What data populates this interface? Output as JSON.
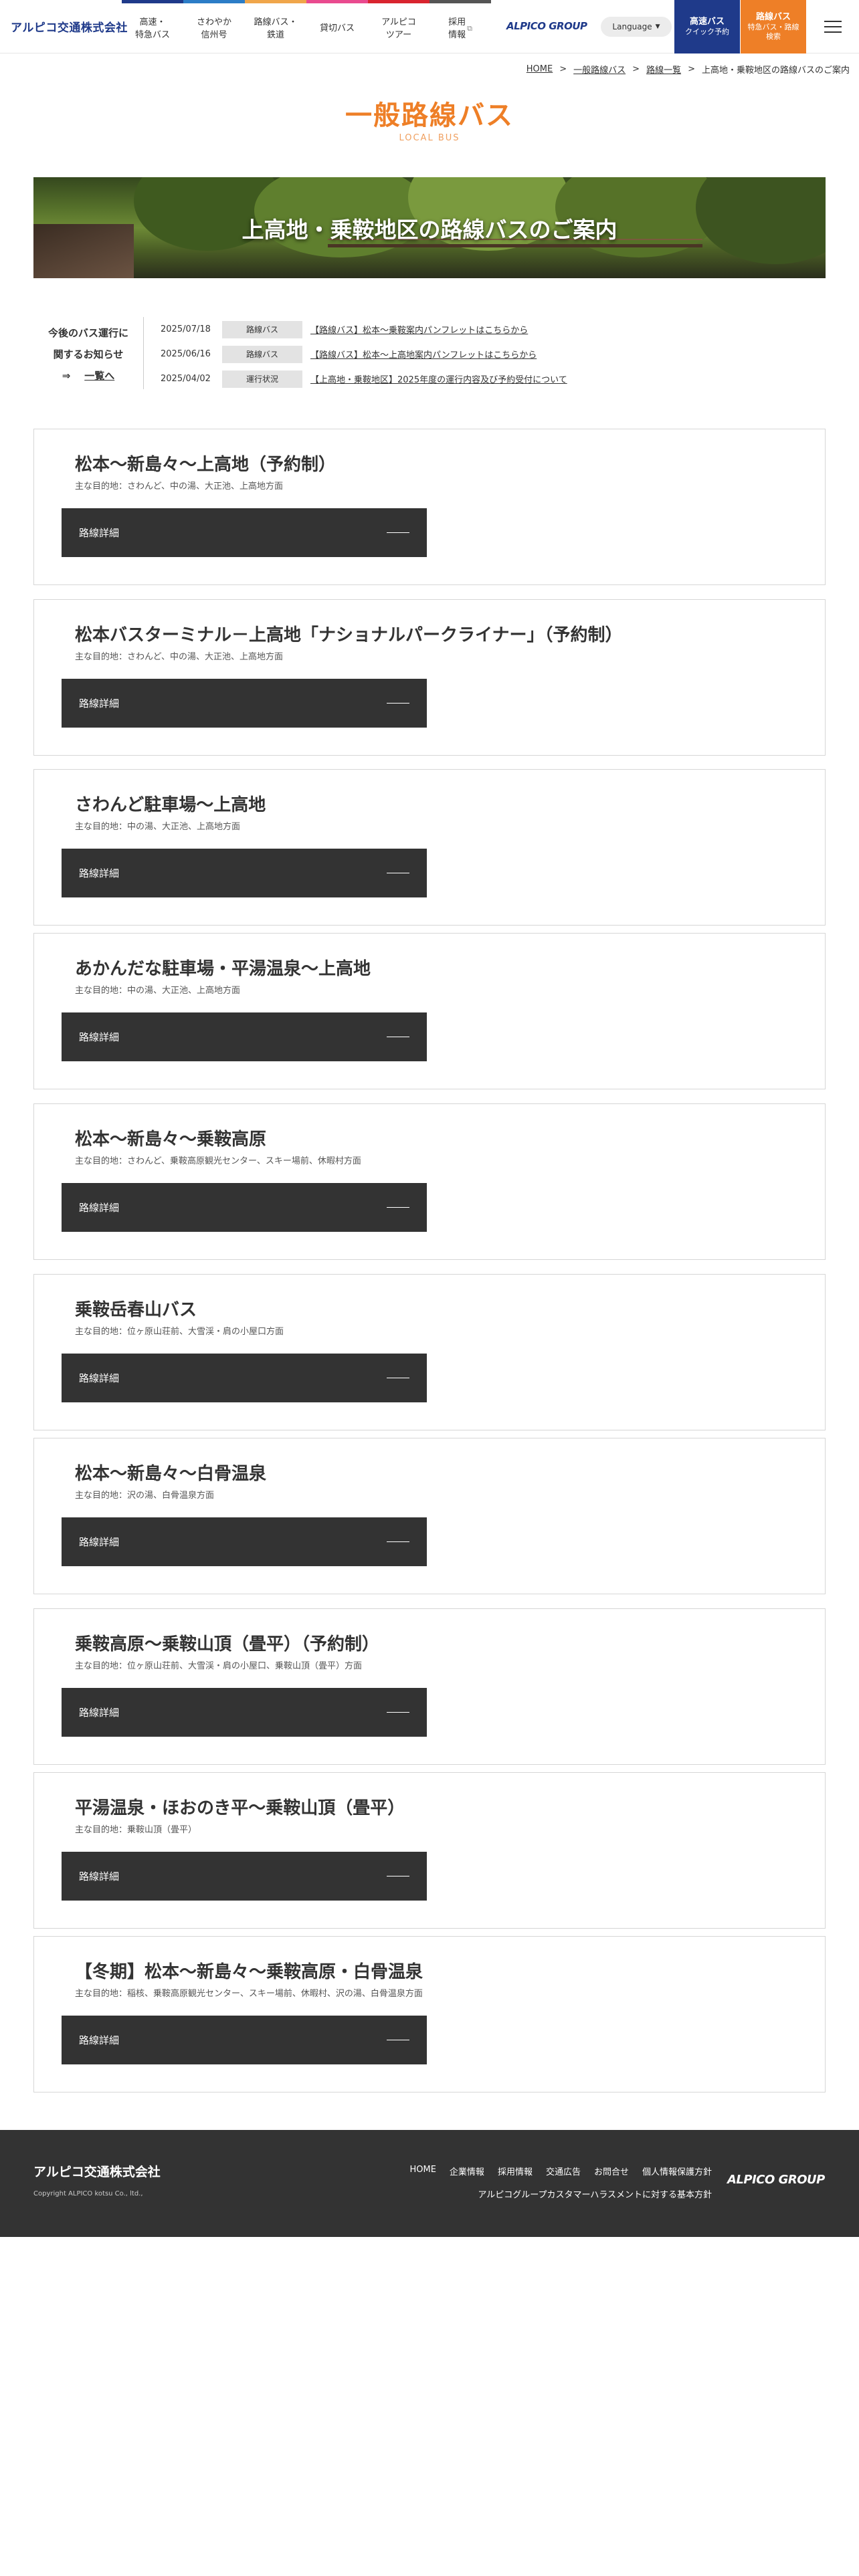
{
  "header": {
    "logo": "アルピコ交通株式会社",
    "nav": [
      {
        "label": "高速・\n特急バス",
        "color": "#1f3a8a",
        "external": false
      },
      {
        "label": "さわやか\n信州号",
        "color": "#2c7dc7",
        "external": false
      },
      {
        "label": "路線バス・\n鉄道",
        "color": "#f0a64a",
        "external": false
      },
      {
        "label": "貸切バス",
        "color": "#e94a8f",
        "external": false
      },
      {
        "label": "アルピコ\nツアー",
        "color": "#d9242f",
        "external": false
      },
      {
        "label": "採用\n情報",
        "color": "#555555",
        "external": true
      }
    ],
    "external_icon": "⧉",
    "group_logo": "ALPICO GROUP",
    "language": "Language",
    "cta_highway": {
      "title": "高速バス",
      "sub": "クイック予約"
    },
    "cta_route": {
      "title": "路線バス",
      "sub": "特急バス・路線\n検索"
    }
  },
  "breadcrumb": {
    "items": [
      "HOME",
      "一般路線バス",
      "路線一覧"
    ],
    "separator": ">",
    "current": "上高地・乗鞍地区の路線バスのご案内"
  },
  "page": {
    "title": "一般路線バス",
    "subtitle": "LOCAL BUS",
    "hero_title": "上高地・乗鞍地区の路線バスのご案内"
  },
  "news": {
    "heading_line1": "今後のバス運行に",
    "heading_line2": "関するお知らせ",
    "more_arrow": "⇒",
    "more": "一覧へ",
    "items": [
      {
        "date": "2025/07/18",
        "tag": "路線バス",
        "text": "【路線バス】松本～乗鞍案内パンフレットはこちらから"
      },
      {
        "date": "2025/06/16",
        "tag": "路線バス",
        "text": "【路線バス】松本～上高地案内パンフレットはこちらから"
      },
      {
        "date": "2025/04/02",
        "tag": "運行状況",
        "text": "【上高地・乗鞍地区】2025年度の運行内容及び予約受付について"
      }
    ]
  },
  "route_button_label": "路線詳細",
  "routes": [
    {
      "title": "松本～新島々～上高地（予約制）",
      "sub": "主な目的地：さわんど、中の湯、大正池、上高地方面"
    },
    {
      "title": "松本バスターミナル－上高地「ナショナルパークライナー」（予約制）",
      "sub": "主な目的地：さわんど、中の湯、大正池、上高地方面"
    },
    {
      "title": "さわんど駐車場～上高地",
      "sub": "主な目的地：中の湯、大正池、上高地方面"
    },
    {
      "title": "あかんだな駐車場・平湯温泉～上高地",
      "sub": "主な目的地：中の湯、大正池、上高地方面"
    },
    {
      "title": "松本～新島々～乗鞍高原",
      "sub": "主な目的地：さわんど、乗鞍高原観光センター、スキー場前、休暇村方面"
    },
    {
      "title": "乗鞍岳春山バス",
      "sub": "主な目的地：位ヶ原山荘前、大雪渓・肩の小屋口方面"
    },
    {
      "title": "松本～新島々～白骨温泉",
      "sub": "主な目的地：沢の湯、白骨温泉方面"
    },
    {
      "title": "乗鞍高原～乗鞍山頂（畳平）（予約制）",
      "sub": "主な目的地：位ヶ原山荘前、大雪渓・肩の小屋口、乗鞍山頂（畳平）方面"
    },
    {
      "title": "平湯温泉・ほおのき平～乗鞍山頂（畳平）",
      "sub": "主な目的地：乗鞍山頂（畳平）"
    },
    {
      "title": "【冬期】松本～新島々～乗鞍高原・白骨温泉",
      "sub": "主な目的地：稲核、乗鞍高原観光センター、スキー場前、休暇村、沢の湯、白骨温泉方面"
    }
  ],
  "footer": {
    "logo": "アルピコ交通株式会社",
    "copyright": "Copyright ALPICO kotsu Co., ltd.,",
    "links": [
      "HOME",
      "企業情報",
      "採用情報",
      "交通広告",
      "お問合せ",
      "個人情報保護方針"
    ],
    "policy": "アルピコグループカスタマーハラスメントに対する基本方針",
    "group_logo": "ALPICO GROUP"
  }
}
